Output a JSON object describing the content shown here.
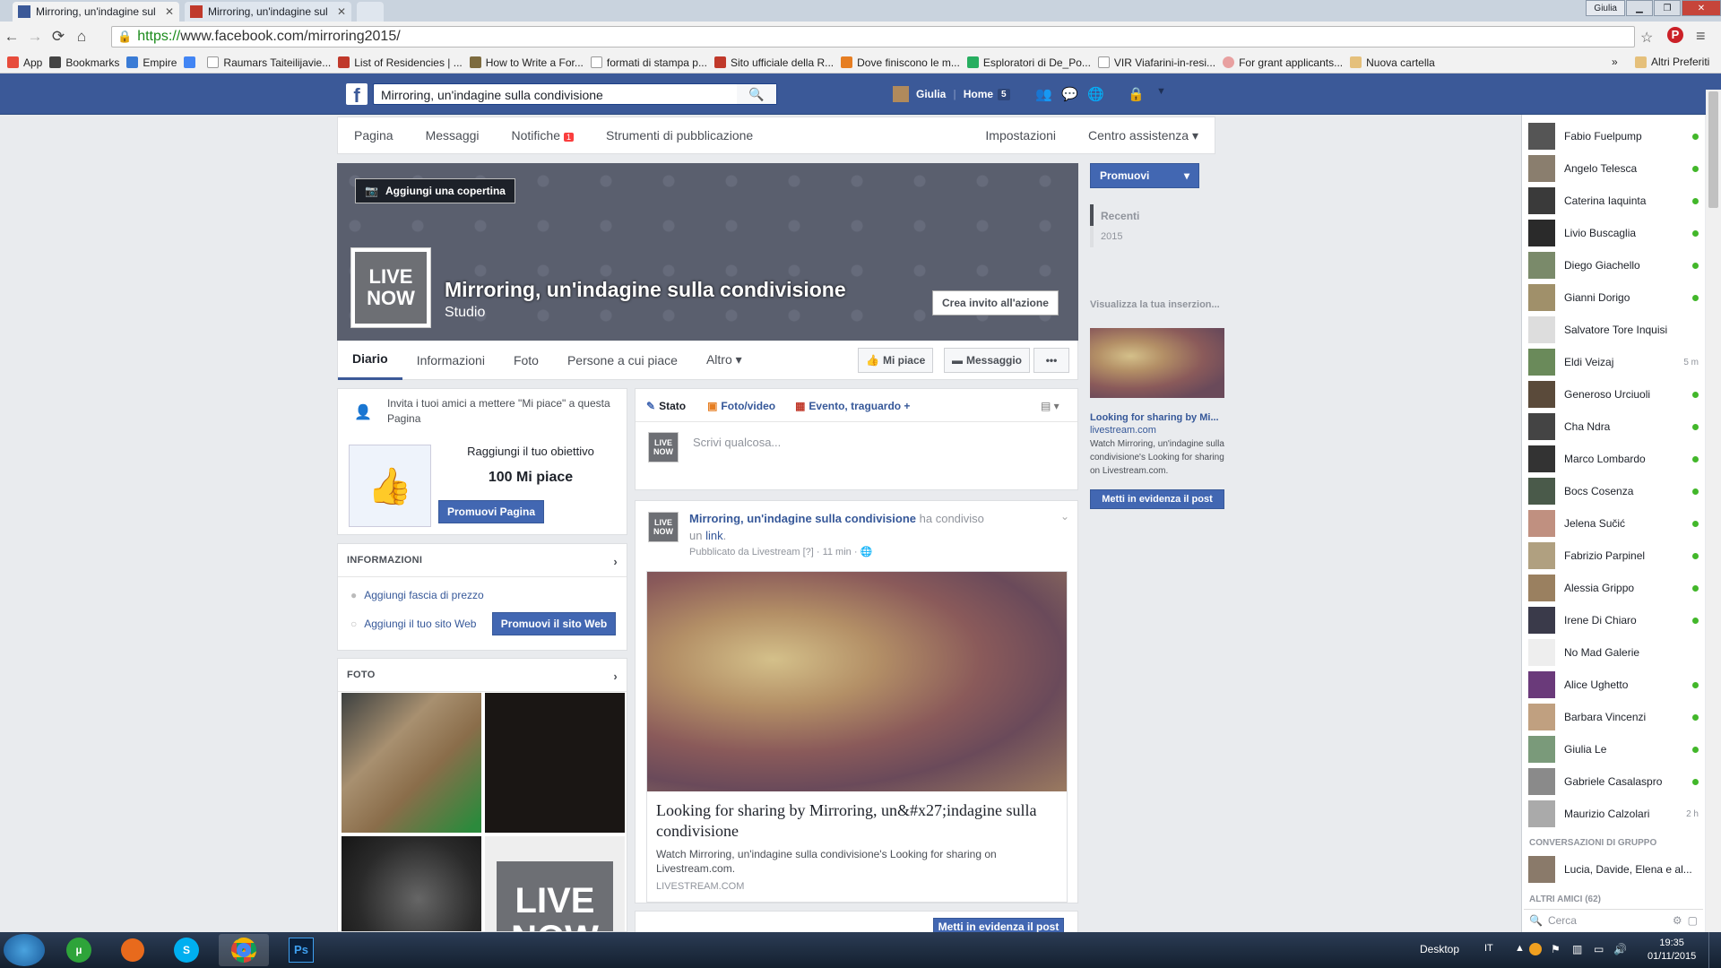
{
  "browser": {
    "tabs": [
      {
        "title": "Mirroring, un'indagine sul",
        "active": true
      },
      {
        "title": "Mirroring, un'indagine sul",
        "active": false
      },
      {
        "title": "",
        "active": false
      }
    ],
    "user_badge": "Giulia",
    "url_scheme": "https://",
    "url_rest": "www.facebook.com/mirroring2015/",
    "bookmarks": [
      "App",
      "Bookmarks",
      "Empire",
      "Raumars Taiteilijavie...",
      "List of Residencies | ...",
      "How to Write a For...",
      "formati di stampa p...",
      "Sito ufficiale della R...",
      "Dove finiscono le m...",
      "Esploratori di De_Po...",
      "VIR Viafarini-in-resi...",
      "For grant applicants...",
      "Nuova cartella"
    ],
    "bookmarks_more": "»",
    "other_bookmarks": "Altri Preferiti"
  },
  "fbbar": {
    "logo": "f",
    "search_value": "Mirroring, un'indagine sulla condivisione",
    "user_name": "Giulia",
    "home_label": "Home",
    "home_count": "5"
  },
  "pagenav": {
    "items": [
      "Pagina",
      "Messaggi",
      "Notifiche",
      "Strumenti di pubblicazione"
    ],
    "notif_count": "1",
    "right_items": [
      "Impostazioni",
      "Centro assistenza ▾"
    ]
  },
  "cover": {
    "add_cover": "Aggiungi una copertina",
    "profile_line1": "LIVE",
    "profile_line2": "NOW",
    "title": "Mirroring, un'indagine sulla condivisione",
    "subtitle": "Studio",
    "cta": "Crea invito all'azione"
  },
  "timeline_tabs": [
    "Diario",
    "Informazioni",
    "Foto",
    "Persone a cui piace",
    "Altro ▾"
  ],
  "timeline_buttons": {
    "like": "Mi piace",
    "message": "Messaggio",
    "more": "•••"
  },
  "left": {
    "invite_text": "Invita i tuoi amici a mettere \"Mi piace\" a questa Pagina",
    "goal_title": "Raggiungi il tuo obiettivo",
    "goal_value": "100 Mi piace",
    "promote_page": "Promuovi Pagina",
    "info_header": "INFORMAZIONI",
    "info_items": [
      "Aggiungi fascia di prezzo",
      "Aggiungi il tuo sito Web"
    ],
    "promote_web": "Promuovi il sito Web",
    "photo_header": "FOTO",
    "photo_thumb_line1": "LIVE",
    "photo_thumb_line2": "NOW"
  },
  "composer": {
    "tabs": [
      "Stato",
      "Foto/video",
      "Evento, traguardo +"
    ],
    "placeholder": "Scrivi qualcosa..."
  },
  "post": {
    "author": "Mirroring, un'indagine sulla condivisione",
    "action": "ha condiviso",
    "action2": "un",
    "link_word": "link",
    "meta": "Pubblicato da Livestream [?] · 11 min · 🌐",
    "link_title": "Looking for sharing by Mirroring, un&#x27;indagine sulla condivisione",
    "link_desc": "Watch Mirroring, un'indagine sulla condivisione's Looking for sharing on Livestream.com.",
    "link_domain": "LIVESTREAM.COM",
    "boost": "Metti in evidenza il post"
  },
  "right": {
    "promote": "Promuovi",
    "years": [
      "Recenti",
      "2015"
    ],
    "ad_header": "Visualizza la tua inserzion...",
    "ad_title": "Looking for sharing by Mi...",
    "ad_domain": "livestream.com",
    "ad_desc": "Watch Mirroring, un'indagine sulla condivisione's Looking for sharing on Livestream.com.",
    "ad_button": "Metti in evidenza il post"
  },
  "chat": {
    "friends": [
      {
        "name": "Fabio Fuelpump",
        "status": "online"
      },
      {
        "name": "Angelo Telesca",
        "status": "online"
      },
      {
        "name": "Caterina Iaquinta",
        "status": "online"
      },
      {
        "name": "Livio Buscaglia",
        "status": "online"
      },
      {
        "name": "Diego Giachello",
        "status": "online"
      },
      {
        "name": "Gianni Dorigo",
        "status": "online"
      },
      {
        "name": "Salvatore Tore Inquisi",
        "status": ""
      },
      {
        "name": "Eldi Veizaj",
        "status": "5 m"
      },
      {
        "name": "Generoso Urciuoli",
        "status": "online"
      },
      {
        "name": "Cha Ndra",
        "status": "online"
      },
      {
        "name": "Marco Lombardo",
        "status": "online"
      },
      {
        "name": "Bocs Cosenza",
        "status": "online"
      },
      {
        "name": "Jelena Sučić",
        "status": "online"
      },
      {
        "name": "Fabrizio Parpinel",
        "status": "online"
      },
      {
        "name": "Alessia Grippo",
        "status": "online"
      },
      {
        "name": "Irene Di Chiaro",
        "status": "online"
      },
      {
        "name": "No Mad Galerie",
        "status": ""
      },
      {
        "name": "Alice Ughetto",
        "status": "online"
      },
      {
        "name": "Barbara Vincenzi",
        "status": "online"
      },
      {
        "name": "Giulia Le",
        "status": "online"
      },
      {
        "name": "Gabriele Casalaspro",
        "status": "online"
      },
      {
        "name": "Maurizio Calzolari",
        "status": "2 h"
      }
    ],
    "group_header": "CONVERSAZIONI DI GRUPPO",
    "group_name": "Lucia, Davide, Elena e al...",
    "more_header": "ALTRI AMICI (62)",
    "search_placeholder": "Cerca"
  },
  "taskbar": {
    "desktop": "Desktop",
    "lang": "IT",
    "time": "19:35",
    "date": "01/11/2015"
  }
}
